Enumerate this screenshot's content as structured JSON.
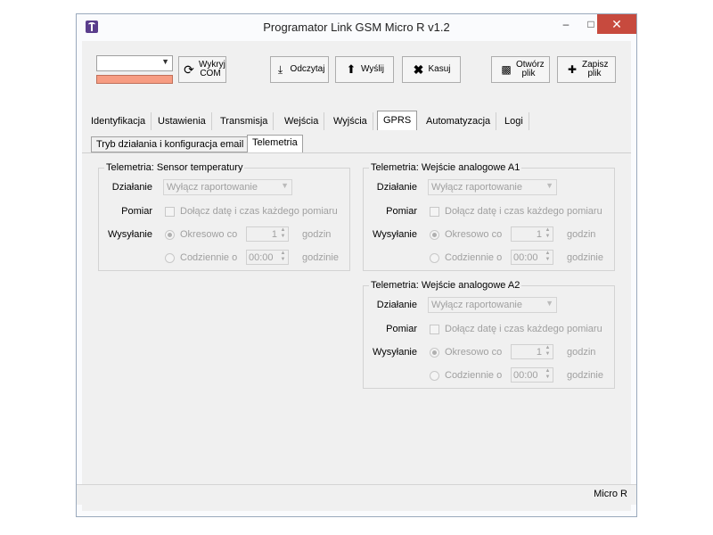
{
  "window": {
    "title": "Programator Link GSM Micro R v1.2"
  },
  "toolbar": {
    "com_value": "",
    "detect_com": "Wykryj COM",
    "read": "Odczytaj",
    "send": "Wyślij",
    "erase": "Kasuj",
    "open_file": "Otwórz plik",
    "save_file": "Zapisz plik"
  },
  "tabs": [
    "Identyfikacja",
    "Ustawienia",
    "Transmisja",
    "Wejścia",
    "Wyjścia",
    "GPRS",
    "Automatyzacja",
    "Logi"
  ],
  "active_tab": "GPRS",
  "subtabs": [
    "Tryb działania i konfiguracja email",
    "Telemetria"
  ],
  "active_subtab": "Telemetria",
  "groups": [
    {
      "title": "Telemetria: Sensor temperatury",
      "labels": {
        "action": "Działanie",
        "measure": "Pomiar",
        "sending": "Wysyłanie"
      },
      "action_value": "Wyłącz raportowanie",
      "measure_check": "Dołącz datę i czas każdego pomiaru",
      "periodic_label": "Okresowo co",
      "periodic_value": "1",
      "periodic_unit": "godzin",
      "daily_label": "Codziennie o",
      "daily_value": "00:00",
      "daily_unit": "godzinie"
    },
    {
      "title": "Telemetria: Wejście analogowe A1",
      "labels": {
        "action": "Działanie",
        "measure": "Pomiar",
        "sending": "Wysyłanie"
      },
      "action_value": "Wyłącz raportowanie",
      "measure_check": "Dołącz datę i czas każdego pomiaru",
      "periodic_label": "Okresowo co",
      "periodic_value": "1",
      "periodic_unit": "godzin",
      "daily_label": "Codziennie o",
      "daily_value": "00:00",
      "daily_unit": "godzinie"
    },
    {
      "title": "Telemetria: Wejście analogowe A2",
      "labels": {
        "action": "Działanie",
        "measure": "Pomiar",
        "sending": "Wysyłanie"
      },
      "action_value": "Wyłącz raportowanie",
      "measure_check": "Dołącz datę i czas każdego pomiaru",
      "periodic_label": "Okresowo co",
      "periodic_value": "1",
      "periodic_unit": "godzin",
      "daily_label": "Codziennie o",
      "daily_value": "00:00",
      "daily_unit": "godzinie"
    }
  ],
  "status": {
    "device": "Micro R"
  },
  "colors": {
    "progress": "#f79c82",
    "close_button": "#c74a3e"
  },
  "icons": {
    "app": "antenna-icon",
    "refresh": "refresh-icon",
    "read": "download-icon",
    "send": "upload-icon",
    "erase": "x-icon",
    "open": "folder-icon",
    "save": "briefcase-plus-icon"
  }
}
